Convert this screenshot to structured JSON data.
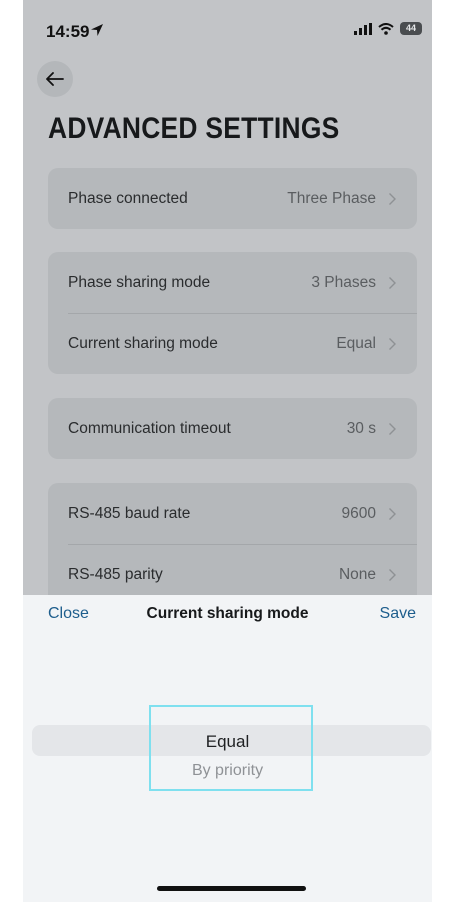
{
  "status_bar": {
    "time": "14:59",
    "battery": "44"
  },
  "page": {
    "title": "ADVANCED SETTINGS"
  },
  "settings": [
    [
      {
        "label": "Phase connected",
        "value": "Three Phase"
      }
    ],
    [
      {
        "label": "Phase sharing mode",
        "value": "3 Phases"
      },
      {
        "label": "Current sharing mode",
        "value": "Equal"
      }
    ],
    [
      {
        "label": "Communication timeout",
        "value": "30 s"
      }
    ],
    [
      {
        "label": "RS-485 baud rate",
        "value": "9600"
      },
      {
        "label": "RS-485 parity",
        "value": "None"
      }
    ]
  ],
  "sheet": {
    "close_label": "Close",
    "title": "Current sharing mode",
    "save_label": "Save",
    "options": [
      "Equal",
      "By priority"
    ],
    "selected": "Equal"
  },
  "colors": {
    "accent": "#1d5d8c",
    "focus_outline": "#7fe0ef"
  }
}
